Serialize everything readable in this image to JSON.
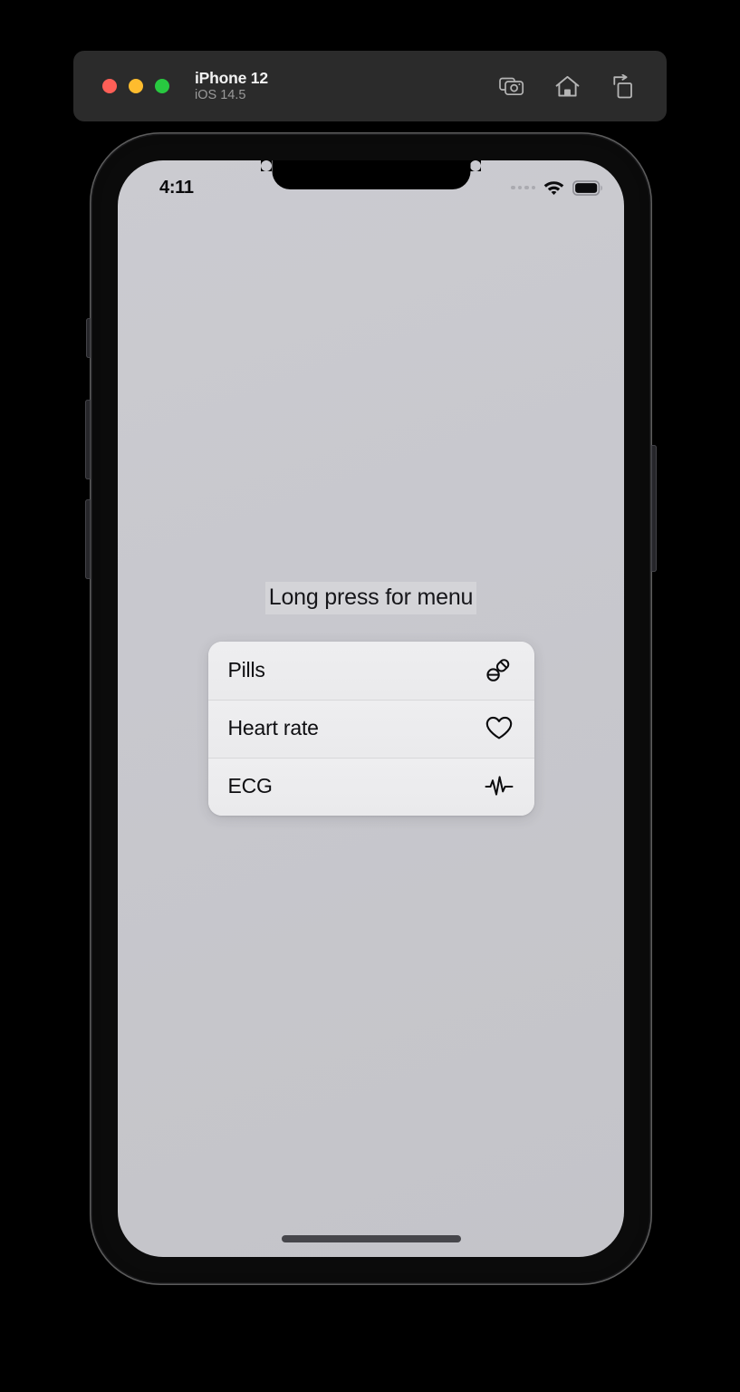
{
  "simulator": {
    "window_controls": [
      {
        "name": "close",
        "color": "#ff5f57"
      },
      {
        "name": "minimize",
        "color": "#febc2e"
      },
      {
        "name": "maximize",
        "color": "#28c840"
      }
    ],
    "device_name": "iPhone 12",
    "os_version": "iOS 14.5",
    "toolbar_buttons": [
      {
        "icon": "screenshot-camera-icon",
        "label": "Screenshot"
      },
      {
        "icon": "home-icon",
        "label": "Home"
      },
      {
        "icon": "rotate-device-icon",
        "label": "Rotate"
      }
    ]
  },
  "status_bar": {
    "time": "4:11",
    "cellular_dots": 4,
    "wifi_icon": "wifi-icon",
    "battery_icon": "battery-full-icon",
    "battery_level": 100
  },
  "screen": {
    "background_color": "#c8c8ce",
    "hint_label": "Long press for menu",
    "context_menu": {
      "background_color": "#ececed",
      "items": [
        {
          "label": "Pills",
          "icon": "pills-icon"
        },
        {
          "label": "Heart rate",
          "icon": "heart-icon"
        },
        {
          "label": "ECG",
          "icon": "ecg-waveform-icon"
        }
      ]
    },
    "home_indicator": true
  }
}
